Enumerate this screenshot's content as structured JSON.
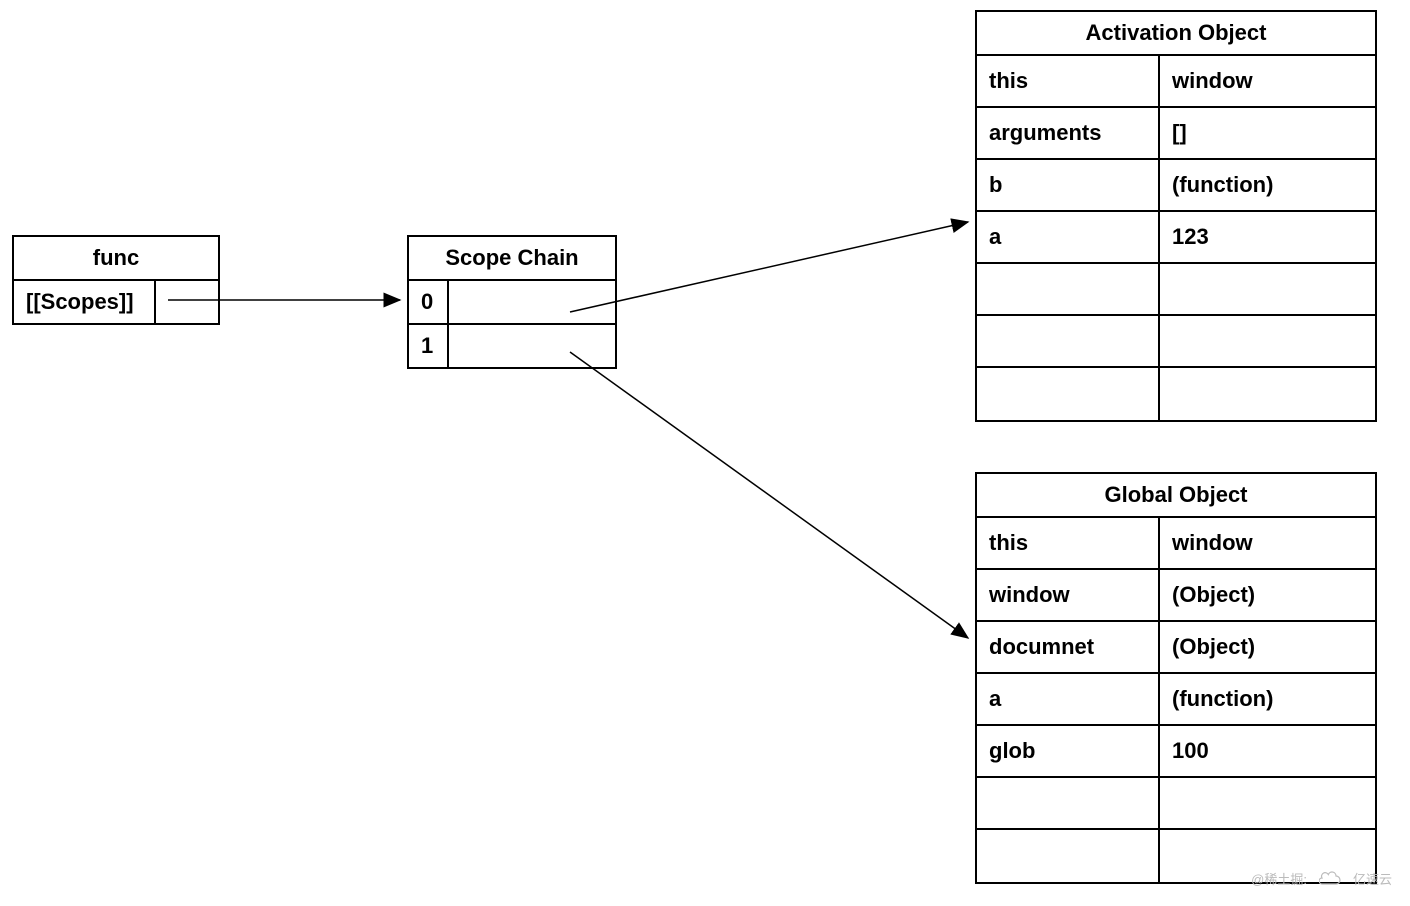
{
  "func": {
    "title": "func",
    "prop_key": "[[Scopes]]",
    "prop_val": ""
  },
  "scope_chain": {
    "title": "Scope Chain",
    "rows": [
      {
        "index": "0",
        "value": ""
      },
      {
        "index": "1",
        "value": ""
      }
    ]
  },
  "activation_object": {
    "title": "Activation Object",
    "rows": [
      {
        "key": "this",
        "value": "window"
      },
      {
        "key": "arguments",
        "value": "[]"
      },
      {
        "key": "b",
        "value": "(function)"
      },
      {
        "key": "a",
        "value": "123"
      },
      {
        "key": "",
        "value": ""
      },
      {
        "key": "",
        "value": ""
      },
      {
        "key": "",
        "value": ""
      }
    ]
  },
  "global_object": {
    "title": "Global Object",
    "rows": [
      {
        "key": "this",
        "value": "window"
      },
      {
        "key": "window",
        "value": "(Object)"
      },
      {
        "key": "documnet",
        "value": "(Object)"
      },
      {
        "key": "a",
        "value": "(function)"
      },
      {
        "key": "glob",
        "value": "100"
      },
      {
        "key": "",
        "value": ""
      },
      {
        "key": "",
        "value": ""
      }
    ]
  },
  "watermark": {
    "source": "@稀土掘:",
    "brand": "亿速云"
  }
}
